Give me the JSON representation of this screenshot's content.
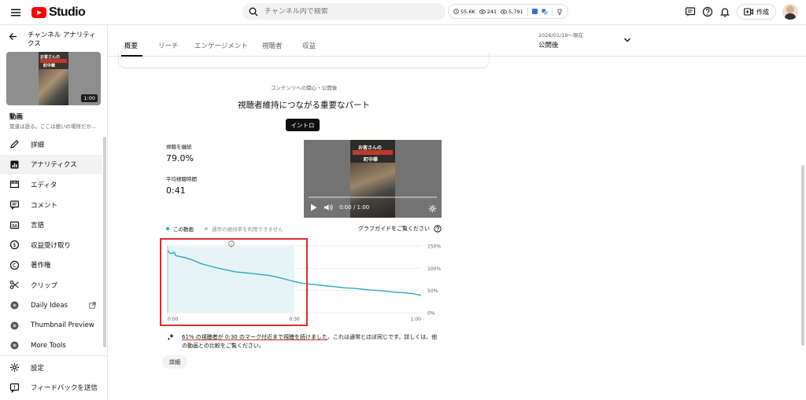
{
  "header": {
    "logo_text": "Studio",
    "search_placeholder": "チャンネル内で検索",
    "stats": {
      "subscribers": "55.6K",
      "views": "241",
      "views_total": "5,791"
    },
    "create_label": "作成"
  },
  "sidebar": {
    "back_title": "チャンネル アナリティクス",
    "thumb_title_line1": "お客さんの",
    "thumb_title_line2": "町中華",
    "thumb_duration": "1:00",
    "video_label": "動画",
    "video_subtitle": "覚道は語る。ここは憩いの場所だか...",
    "items": [
      {
        "label": "詳細",
        "icon": "pencil-icon"
      },
      {
        "label": "アナリティクス",
        "icon": "analytics-icon",
        "active": true
      },
      {
        "label": "エディタ",
        "icon": "editor-icon"
      },
      {
        "label": "コメント",
        "icon": "comment-icon"
      },
      {
        "label": "言語",
        "icon": "subtitles-icon"
      },
      {
        "label": "収益受け取り",
        "icon": "dollar-icon"
      },
      {
        "label": "著作権",
        "icon": "copyright-icon"
      },
      {
        "label": "クリップ",
        "icon": "scissors-icon"
      },
      {
        "label": "Daily Ideas",
        "icon": "extension-icon",
        "external": true
      },
      {
        "label": "Thumbnail Preview",
        "icon": "extension-icon"
      },
      {
        "label": "More Tools",
        "icon": "extension-icon"
      }
    ],
    "bottom_items": [
      {
        "label": "設定",
        "icon": "gear-icon"
      },
      {
        "label": "フィードバックを送信",
        "icon": "feedback-icon"
      }
    ]
  },
  "tabs": {
    "items": [
      "概要",
      "リーチ",
      "エンゲージメント",
      "視聴者",
      "収益"
    ],
    "active": 0,
    "date_range": "2026/01/19～現在",
    "date_value": "公開後"
  },
  "content": {
    "section_subtitle": "コンテンツへの関心・公開後",
    "section_title": "視聴者維持につながる重要なパート",
    "chip_label": "イントロ",
    "metric1_label": "視聴を継続",
    "metric1_value": "79.0%",
    "metric2_label": "平均視聴時間",
    "metric2_value": "0:41",
    "player_time": "0:00 / 1:00",
    "legend_this": "この動画",
    "legend_typical": "通常の維持率を利用できません",
    "guide_link": "グラフガイドをご覧ください",
    "insight_underlined": "61% の視聴者が 0:30 のマーク付近まで視聴を続けました",
    "insight_rest": "。これは通常とほぼ同じです。詳しくは、他の動画との比較をご覧ください。",
    "detail_button": "詳細",
    "marker_label": "i"
  },
  "chart_data": {
    "type": "line",
    "x_tick_labels": [
      "0:00",
      "0:30",
      "1:00"
    ],
    "y_tick_labels": [
      "150%",
      "100%",
      "50%",
      "0%"
    ],
    "xlim": [
      0,
      60
    ],
    "ylim": [
      0,
      150
    ],
    "highlight_range": [
      0,
      30
    ],
    "series": [
      {
        "name": "この動画",
        "x": [
          0,
          0.5,
          1,
          1.5,
          2,
          3,
          4,
          6,
          8,
          10,
          12,
          14,
          16,
          18,
          20,
          22,
          24,
          26,
          28,
          30,
          32,
          34,
          36,
          38,
          40,
          42,
          44,
          46,
          48,
          50,
          52,
          54,
          56,
          58,
          60
        ],
        "y": [
          140,
          134,
          133,
          136,
          128,
          126,
          124,
          118,
          110,
          105,
          100,
          96,
          92,
          90,
          88,
          86,
          84,
          80,
          75,
          70,
          66,
          64,
          62,
          60,
          58,
          56,
          55,
          53,
          51,
          50,
          48,
          46,
          45,
          43,
          39
        ]
      }
    ],
    "colors": {
      "line": "#2aa7c9",
      "fill": "#e6f4f8",
      "legend_this": "#12b5a5",
      "legend_typical": "#c4c4c4"
    }
  }
}
